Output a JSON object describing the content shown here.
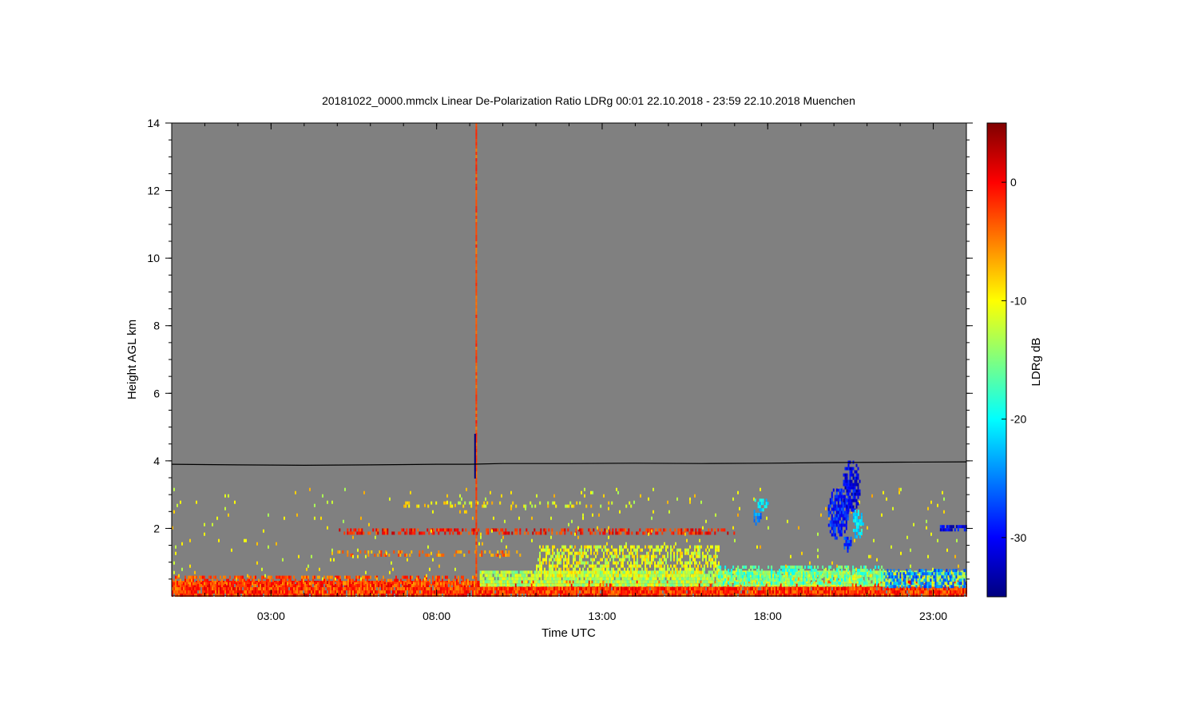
{
  "chart_data": {
    "type": "heatmap",
    "title": "20181022_0000.mmclx Linear De-Polarization Ratio LDRg   00:01 22.10.2018 - 23:59 22.10.2018 Muenchen",
    "xlabel": "Time UTC",
    "ylabel": "Height AGL km",
    "colorbar_label": "LDRg dB",
    "xlim": [
      0.0,
      24.0
    ],
    "ylim": [
      0.0,
      14.0
    ],
    "clim": [
      -35,
      5
    ],
    "x_ticks": [
      {
        "value": 3.0,
        "label": "03:00"
      },
      {
        "value": 8.0,
        "label": "08:00"
      },
      {
        "value": 13.0,
        "label": "13:00"
      },
      {
        "value": 18.0,
        "label": "18:00"
      },
      {
        "value": 23.0,
        "label": "23:00"
      }
    ],
    "y_ticks": [
      {
        "value": 2,
        "label": "2"
      },
      {
        "value": 4,
        "label": "4"
      },
      {
        "value": 6,
        "label": "6"
      },
      {
        "value": 8,
        "label": "8"
      },
      {
        "value": 10,
        "label": "10"
      },
      {
        "value": 12,
        "label": "12"
      },
      {
        "value": 14,
        "label": "14"
      }
    ],
    "colorbar_ticks": [
      {
        "value": 0,
        "label": "0"
      },
      {
        "value": -10,
        "label": "-10"
      },
      {
        "value": -20,
        "label": "-20"
      },
      {
        "value": -30,
        "label": "-30"
      }
    ],
    "background_color": "#808080",
    "colormap": "jet",
    "grid": false,
    "line_series": [
      {
        "type": "line",
        "color": "#000000",
        "x": [
          0.0,
          2.0,
          4.0,
          6.0,
          8.0,
          9.0,
          10.0,
          12.0,
          14.0,
          16.0,
          18.0,
          20.0,
          22.0,
          24.0
        ],
        "y": [
          3.9,
          3.88,
          3.87,
          3.88,
          3.9,
          3.9,
          3.92,
          3.92,
          3.93,
          3.92,
          3.93,
          3.95,
          3.96,
          3.97
        ]
      }
    ],
    "features": [
      {
        "shape": "band",
        "x0": 0.0,
        "x1": 24.0,
        "y0": 0.05,
        "y1": 0.45,
        "value": -2,
        "density": 0.95
      },
      {
        "shape": "band",
        "x0": 0.0,
        "x1": 9.2,
        "y0": 0.35,
        "y1": 0.6,
        "value": -3,
        "density": 0.6
      },
      {
        "shape": "band",
        "x0": 9.3,
        "x1": 24.0,
        "y0": 0.3,
        "y1": 0.75,
        "value": -13,
        "density": 0.9
      },
      {
        "shape": "band",
        "x0": 11.0,
        "x1": 16.5,
        "y0": 0.6,
        "y1": 1.5,
        "value": -11,
        "density": 0.55
      },
      {
        "shape": "band",
        "x0": 16.5,
        "x1": 21.5,
        "y0": 0.4,
        "y1": 0.9,
        "value": -17,
        "density": 0.5
      },
      {
        "shape": "band",
        "x0": 21.5,
        "x1": 24.0,
        "y0": 0.3,
        "y1": 0.8,
        "value": -25,
        "density": 0.55
      },
      {
        "shape": "band",
        "x0": 5.0,
        "x1": 17.0,
        "y0": 1.85,
        "y1": 2.0,
        "value": -1,
        "density": 0.5
      },
      {
        "shape": "band",
        "x0": 5.0,
        "x1": 10.5,
        "y0": 1.25,
        "y1": 1.35,
        "value": -5,
        "density": 0.35
      },
      {
        "shape": "band",
        "x0": 7.0,
        "x1": 14.0,
        "y0": 2.7,
        "y1": 2.8,
        "value": -10,
        "density": 0.25
      },
      {
        "shape": "band",
        "x0": 0.0,
        "x1": 24.0,
        "y0": 0.5,
        "y1": 3.2,
        "value": -10,
        "density": 0.02
      },
      {
        "shape": "blob",
        "x": 20.1,
        "y": 2.5,
        "w": 0.65,
        "h": 1.55,
        "value": -29
      },
      {
        "shape": "blob",
        "x": 20.5,
        "y": 3.3,
        "w": 0.55,
        "h": 1.6,
        "value": -31
      },
      {
        "shape": "blob",
        "x": 20.7,
        "y": 2.2,
        "w": 0.35,
        "h": 0.9,
        "value": -21
      },
      {
        "shape": "blob",
        "x": 20.4,
        "y": 1.6,
        "w": 0.3,
        "h": 0.5,
        "value": -28
      },
      {
        "shape": "blob",
        "x": 17.8,
        "y": 2.75,
        "w": 0.5,
        "h": 0.45,
        "value": -21
      },
      {
        "shape": "blob",
        "x": 17.65,
        "y": 2.4,
        "w": 0.25,
        "h": 0.5,
        "value": -25
      },
      {
        "shape": "band",
        "x0": 23.2,
        "x1": 24.0,
        "y0": 1.95,
        "y1": 2.1,
        "value": -31,
        "density": 0.7
      },
      {
        "shape": "column",
        "x": 9.2,
        "y0": 0.0,
        "y1": 14.0,
        "value": -3
      },
      {
        "shape": "column",
        "x": 9.16,
        "y0": 3.5,
        "y1": 4.8,
        "value": -38
      }
    ]
  }
}
